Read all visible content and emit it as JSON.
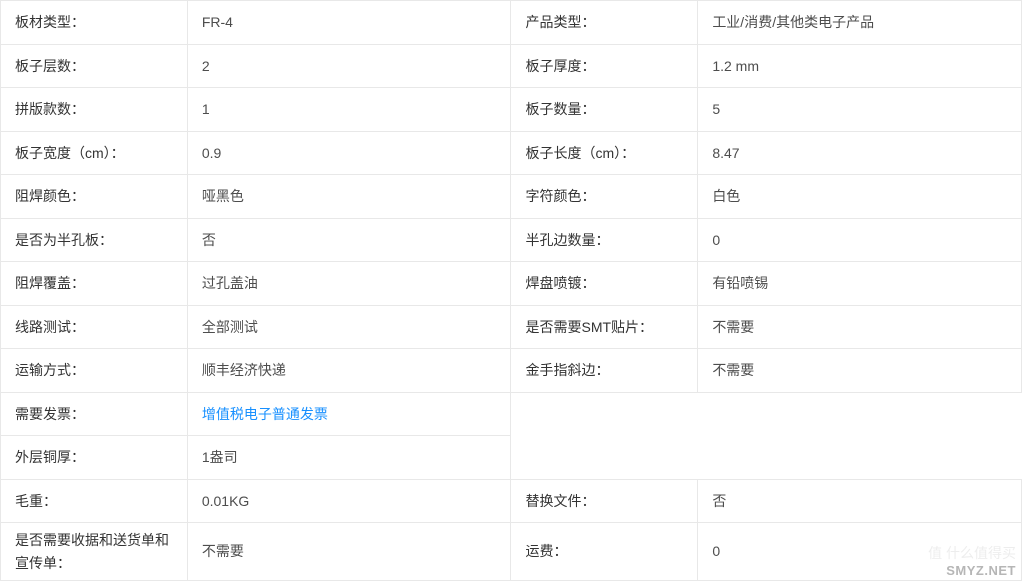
{
  "rows": [
    {
      "l1": "板材类型：",
      "v1": "FR-4",
      "l2": "产品类型：",
      "v2": "工业/消费/其他类电子产品",
      "v1link": false
    },
    {
      "l1": "板子层数：",
      "v1": "2",
      "l2": "板子厚度：",
      "v2": "1.2 mm",
      "v1link": false
    },
    {
      "l1": "拼版款数：",
      "v1": "1",
      "l2": "板子数量：",
      "v2": "5",
      "v1link": false
    },
    {
      "l1": "板子宽度（cm）：",
      "v1": "0.9",
      "l2": "板子长度（cm）：",
      "v2": "8.47",
      "v1link": false
    },
    {
      "l1": "阻焊颜色：",
      "v1": "哑黑色",
      "l2": "字符颜色：",
      "v2": "白色",
      "v1link": false
    },
    {
      "l1": "是否为半孔板：",
      "v1": "否",
      "l2": "半孔边数量：",
      "v2": "0",
      "v1link": false
    },
    {
      "l1": "阻焊覆盖：",
      "v1": "过孔盖油",
      "l2": "焊盘喷镀：",
      "v2": "有铅喷锡",
      "v1link": false
    },
    {
      "l1": "线路测试：",
      "v1": "全部测试",
      "l2": "是否需要SMT贴片：",
      "v2": "不需要",
      "v1link": false
    },
    {
      "l1": "运输方式：",
      "v1": "顺丰经济快递",
      "l2": "金手指斜边：",
      "v2": "不需要",
      "v1link": false
    },
    {
      "l1": "需要发票：",
      "v1": "增值税电子普通发票",
      "l2": "",
      "v2": "",
      "v1link": true,
      "right_empty": true
    },
    {
      "l1": "外层铜厚：",
      "v1": "1盎司",
      "l2": "",
      "v2": "",
      "v1link": false,
      "right_empty": true
    },
    {
      "l1": "毛重：",
      "v1": "0.01KG",
      "l2": "替换文件：",
      "v2": "否",
      "v1link": false
    },
    {
      "l1": "是否需要收据和送货单和宣传单：",
      "v1": "不需要",
      "l2": "运费：",
      "v2": "0",
      "v1link": false,
      "tall": true
    }
  ],
  "watermark": "SMYZ.NET",
  "watermark_faint": "值 什么值得买"
}
